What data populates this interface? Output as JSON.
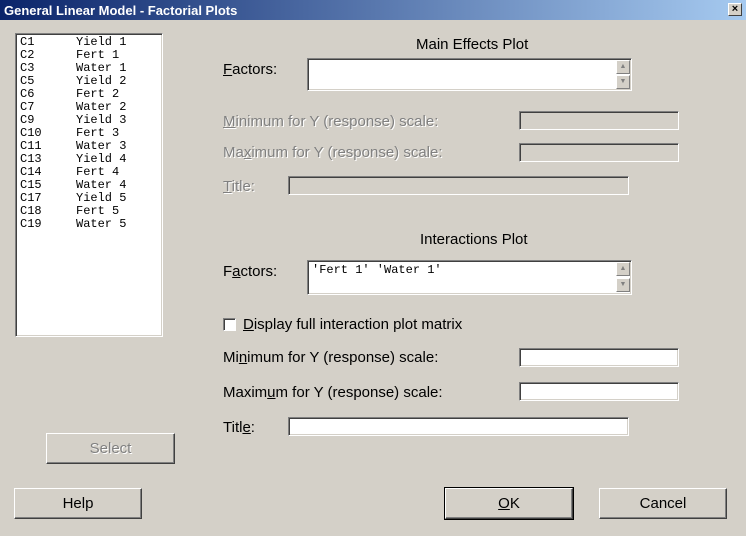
{
  "window": {
    "title": "General Linear Model - Factorial Plots",
    "close_label": "×"
  },
  "variables": [
    {
      "id": "C1",
      "name": "Yield 1"
    },
    {
      "id": "C2",
      "name": "Fert 1"
    },
    {
      "id": "C3",
      "name": "Water 1"
    },
    {
      "id": "C5",
      "name": "Yield 2"
    },
    {
      "id": "C6",
      "name": "Fert 2"
    },
    {
      "id": "C7",
      "name": "Water 2"
    },
    {
      "id": "C9",
      "name": "Yield 3"
    },
    {
      "id": "C10",
      "name": "Fert 3"
    },
    {
      "id": "C11",
      "name": "Water 3"
    },
    {
      "id": "C13",
      "name": "Yield 4"
    },
    {
      "id": "C14",
      "name": "Fert 4"
    },
    {
      "id": "C15",
      "name": "Water 4"
    },
    {
      "id": "C17",
      "name": "Yield 5"
    },
    {
      "id": "C18",
      "name": "Fert 5"
    },
    {
      "id": "C19",
      "name": "Water 5"
    }
  ],
  "main_effects": {
    "section_title": "Main Effects Plot",
    "factors_label_pre": "",
    "factors_label_u": "F",
    "factors_label_post": "actors:",
    "factors_value": "",
    "min_label_pre": "",
    "min_label_u": "M",
    "min_label_post": "inimum for Y (response) scale:",
    "min_value": "",
    "max_label_pre": "Ma",
    "max_label_u": "x",
    "max_label_post": "imum for Y (response) scale:",
    "max_value": "",
    "title_label_pre": "",
    "title_label_u": "T",
    "title_label_post": "itle:",
    "title_value": ""
  },
  "interactions": {
    "section_title": "Interactions Plot",
    "factors_label_pre": "F",
    "factors_label_u": "a",
    "factors_label_post": "ctors:",
    "factors_value": "'Fert 1' 'Water 1'",
    "display_matrix_label_pre": "",
    "display_matrix_label_u": "D",
    "display_matrix_label_post": "isplay full interaction plot matrix",
    "display_matrix_checked": false,
    "min_label_pre": "Mi",
    "min_label_u": "n",
    "min_label_post": "imum for Y (response) scale:",
    "min_value": "",
    "max_label_pre": "Maxim",
    "max_label_u": "u",
    "max_label_post": "m for Y (response) scale:",
    "max_value": "",
    "title_label_pre": "Titl",
    "title_label_u": "e",
    "title_label_post": ":",
    "title_value": ""
  },
  "buttons": {
    "select": "Select",
    "help": "Help",
    "ok_u": "O",
    "ok_post": "K",
    "cancel": "Cancel"
  }
}
